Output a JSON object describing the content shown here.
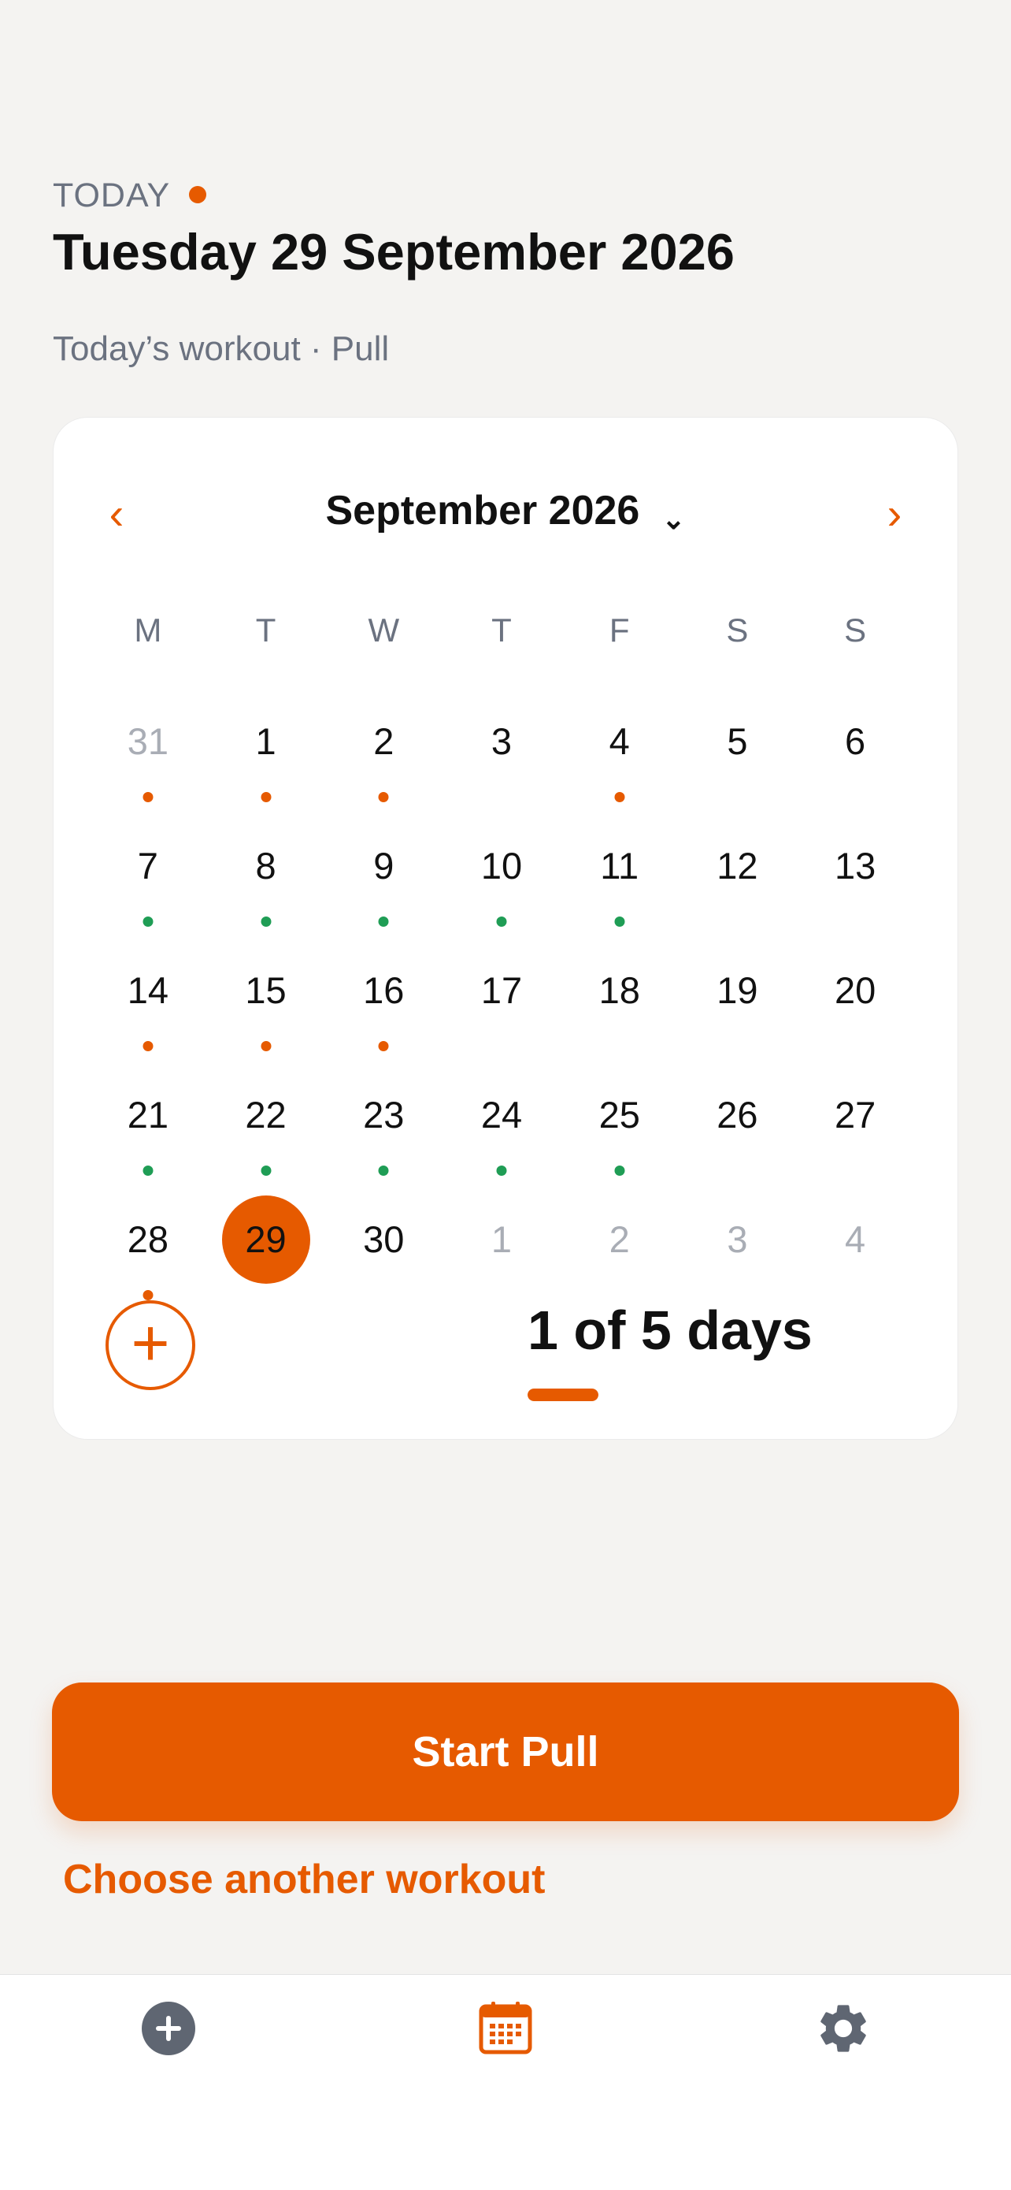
{
  "header": {
    "today_label": "TODAY",
    "date_title": "Tuesday 29 September 2026",
    "workout_subtitle": "Today’s workout · Pull"
  },
  "colors": {
    "accent": "#e65a00",
    "completed": "#1f9d55",
    "muted": "#a9adb5",
    "background": "#f4f3f1"
  },
  "calendar": {
    "prev_label": "‹",
    "next_label": "›",
    "month_title": "September 2026",
    "month_chevron": "⌄",
    "weekdays": [
      "M",
      "T",
      "W",
      "T",
      "F",
      "S",
      "S"
    ],
    "days": [
      {
        "n": "31",
        "muted": true,
        "dot": "orange"
      },
      {
        "n": "1",
        "dot": "orange"
      },
      {
        "n": "2",
        "dot": "orange"
      },
      {
        "n": "3"
      },
      {
        "n": "4",
        "dot": "orange"
      },
      {
        "n": "5"
      },
      {
        "n": "6"
      },
      {
        "n": "7",
        "dot": "green"
      },
      {
        "n": "8",
        "dot": "green"
      },
      {
        "n": "9",
        "dot": "green"
      },
      {
        "n": "10",
        "dot": "green"
      },
      {
        "n": "11",
        "dot": "green"
      },
      {
        "n": "12"
      },
      {
        "n": "13"
      },
      {
        "n": "14",
        "dot": "orange"
      },
      {
        "n": "15",
        "dot": "orange"
      },
      {
        "n": "16",
        "dot": "orange"
      },
      {
        "n": "17"
      },
      {
        "n": "18"
      },
      {
        "n": "19"
      },
      {
        "n": "20"
      },
      {
        "n": "21",
        "dot": "green"
      },
      {
        "n": "22",
        "dot": "green"
      },
      {
        "n": "23",
        "dot": "green"
      },
      {
        "n": "24",
        "dot": "green"
      },
      {
        "n": "25",
        "dot": "green"
      },
      {
        "n": "26"
      },
      {
        "n": "27"
      },
      {
        "n": "28",
        "dot": "orange"
      },
      {
        "n": "29",
        "selected": true
      },
      {
        "n": "30"
      },
      {
        "n": "1",
        "muted": true
      },
      {
        "n": "2",
        "muted": true
      },
      {
        "n": "3",
        "muted": true
      },
      {
        "n": "4",
        "muted": true
      }
    ],
    "add_label": "+",
    "progress_text": "1 of 5 days",
    "progress_fraction": 1.0
  },
  "actions": {
    "start_label": "Start Pull",
    "choose_label": "Choose another workout"
  },
  "tabbar": {
    "items": [
      {
        "icon": "add-circle-icon"
      },
      {
        "icon": "calendar-icon",
        "active": true
      },
      {
        "icon": "gear-icon"
      }
    ]
  }
}
